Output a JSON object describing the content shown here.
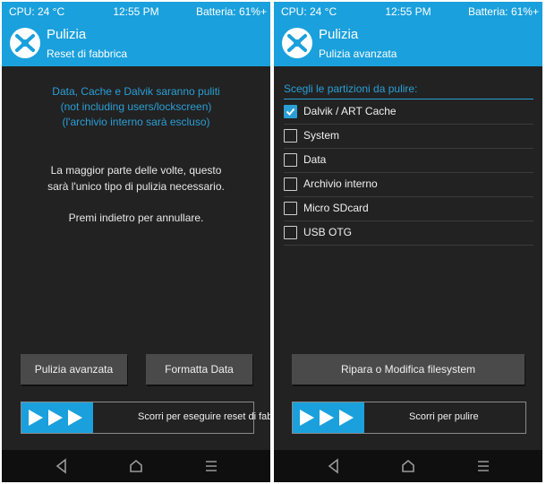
{
  "colors": {
    "accent": "#1aa0dc",
    "panel_bg": "#222222",
    "button_bg": "#4a4a4a",
    "navbar_bg": "#0f0f0f"
  },
  "status": {
    "cpu": "CPU: 24 °C",
    "time": "12:55 PM",
    "battery": "Batteria: 61%+"
  },
  "left": {
    "header": {
      "title": "Pulizia",
      "subtitle": "Reset di fabbrica"
    },
    "info_blue": [
      "Data, Cache e Dalvik saranno puliti",
      "(not including users/lockscreen)",
      "(l'archivio interno sarà escluso)"
    ],
    "info_white": [
      "La maggior parte delle volte, questo",
      "sarà l'unico tipo di pulizia necessario."
    ],
    "back_note": "Premi indietro per annullare.",
    "buttons": {
      "advanced": "Pulizia avanzata",
      "format": "Formatta Data"
    },
    "slider": "Scorri per eseguire reset di fabbrica"
  },
  "right": {
    "header": {
      "title": "Pulizia",
      "subtitle": "Pulizia avanzata"
    },
    "section_title": "Scegli le partizioni da pulire:",
    "partitions": [
      {
        "label": "Dalvik / ART Cache",
        "checked": true
      },
      {
        "label": "System",
        "checked": false
      },
      {
        "label": "Data",
        "checked": false
      },
      {
        "label": "Archivio interno",
        "checked": false
      },
      {
        "label": "Micro SDcard",
        "checked": false
      },
      {
        "label": "USB OTG",
        "checked": false
      }
    ],
    "repair_button": "Ripara o Modifica filesystem",
    "slider": "Scorri per pulire"
  },
  "icons": [
    "twrp-logo-icon",
    "slide-arrows-icon",
    "nav-back-icon",
    "nav-home-icon",
    "nav-recents-icon",
    "checkmark-icon"
  ]
}
